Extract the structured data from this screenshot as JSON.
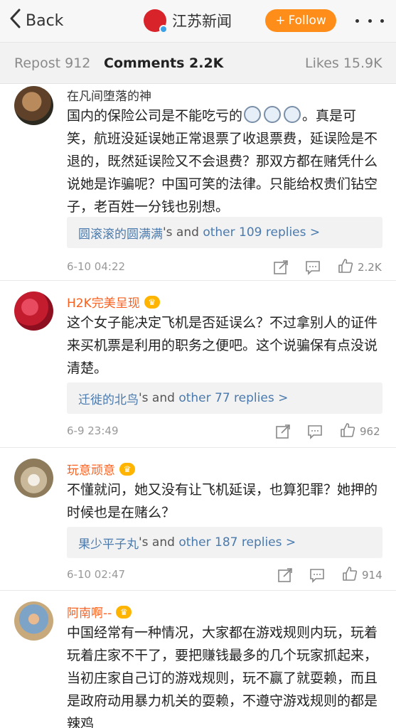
{
  "navbar": {
    "back_label": "Back",
    "title": "江苏新闻",
    "follow_label": "Follow"
  },
  "tabs": [
    {
      "label": "Repost 912"
    },
    {
      "label": "Comments 2.2K"
    },
    {
      "label": "Likes 15.9K"
    }
  ],
  "comments": [
    {
      "username": "在凡间堕落的神",
      "text_a": "国内的保险公司是不能吃亏的",
      "text_b": "。真是可笑，航班没延误她正常退票了收退票费，延误险是不退的，既然延误险又不会退费？那双方都在赌凭什么说她是诈骗呢？中国可笑的法律。只能给权贵们钻空子，老百姓一分钱也别想。",
      "reply_user": "圆滚滚的圆满满",
      "reply_mid": "'s and ",
      "reply_more": "other 109 replies >",
      "time": "6-10 04:22",
      "likes": "2.2K"
    },
    {
      "username": "H2K完美呈现",
      "text": "这个女子能决定飞机是否延误么？不过拿别人的证件来买机票是利用的职务之便吧。这个说骗保有点没说清楚。",
      "reply_user": "迁徙的北鸟",
      "reply_mid": "'s and ",
      "reply_more": "other 77 replies >",
      "time": "6-9 23:49",
      "likes": "962"
    },
    {
      "username": "玩意顽意",
      "text": "不懂就问，她又没有让飞机延误，也算犯罪？她押的时候也是在赌么？",
      "reply_user": "果少平子丸",
      "reply_mid": "'s and ",
      "reply_more": "other 187 replies >",
      "time": "6-10 02:47",
      "likes": "914"
    },
    {
      "username": "阿南啊--",
      "text": "中国经常有一种情况，大家都在游戏规则内玩，玩着玩着庄家不干了，要把赚钱最多的几个玩家抓起来，当初庄家自己订的游戏规则，玩不赢了就耍赖，而且是政府动用暴力机关的耍赖，不遵守游戏规则的都是辣鸡"
    }
  ],
  "icons": {
    "back": "chevron-left-icon",
    "more": "more-dots-icon",
    "repost": "repost-icon",
    "comment": "comment-icon",
    "like": "thumbs-up-icon",
    "crown": "vip-crown-icon"
  },
  "colors": {
    "follow_bg": "#ff8d1a",
    "vip_name": "#f86120",
    "link": "#4a7aad",
    "logo": "#d8232a"
  }
}
